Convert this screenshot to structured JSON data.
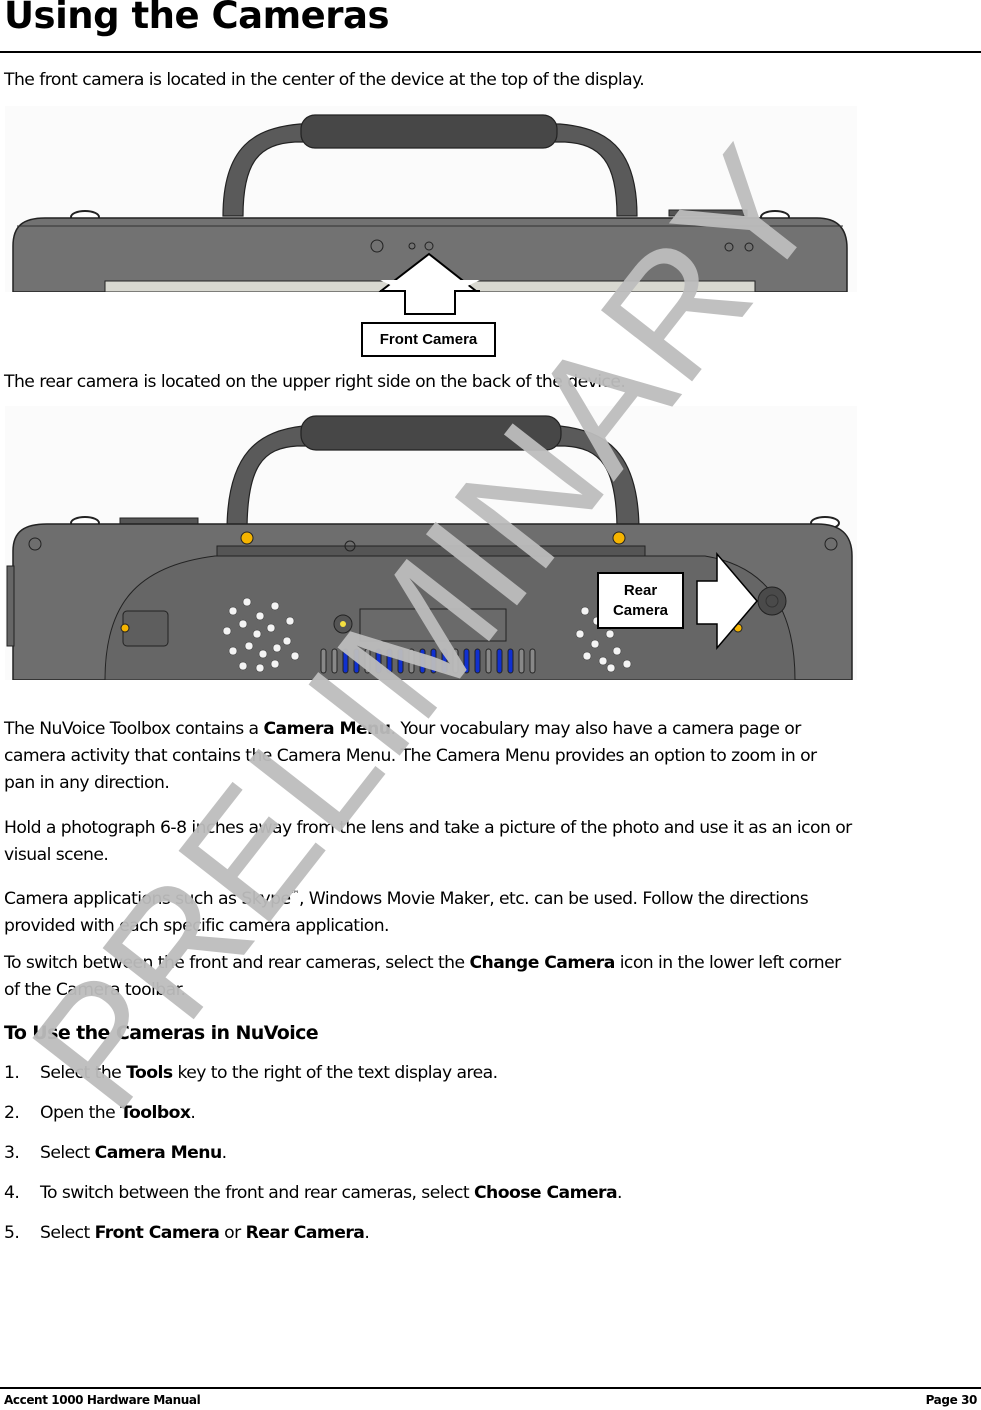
{
  "page": {
    "title": "Using the Cameras",
    "intro_front": "The front camera is located in the center of the device at the top of the display.",
    "intro_rear": "The rear camera is located on the upper right side on the back of the device."
  },
  "figures": {
    "front": {
      "callout_label": "Front Camera"
    },
    "rear": {
      "callout_line1": "Rear",
      "callout_line2": "Camera"
    }
  },
  "body": {
    "p1": {
      "pre": "The NuVoice Toolbox contains a ",
      "bold": "Camera Menu",
      "post_line1": ". Your vocabulary may also have a camera page or",
      "line2": "camera activity that contains the Camera Menu. The Camera Menu provides an option to zoom in or",
      "line3": "pan in any direction."
    },
    "p2": {
      "line1": "Hold a photograph 6-8 inches away from the lens and take a picture of the photo and use it as an icon or",
      "line2": "visual scene."
    },
    "p3": {
      "pre": "Camera applications such as Skype",
      "tm": "™",
      "post": ", Windows Movie Maker, etc. can be used. Follow the directions",
      "line2": "provided with each specific camera application."
    },
    "p4": {
      "pre": "To switch between the front and rear cameras, select the ",
      "bold": "Change Camera",
      "post": " icon in the lower left corner",
      "line2": "of the Camera toolbar."
    }
  },
  "section": {
    "heading": "To Use the Cameras in NuVoice",
    "steps": [
      {
        "num": "1.",
        "pre": "Select the ",
        "bold": "Tools",
        "post": " key to the right of the text display area.",
        "bold2": "",
        "post2": ""
      },
      {
        "num": "2.",
        "pre": "Open the ",
        "bold": "Toolbox",
        "post": ".",
        "bold2": "",
        "post2": ""
      },
      {
        "num": "3.",
        "pre": "Select ",
        "bold": "Camera Menu",
        "post": ".",
        "bold2": "",
        "post2": ""
      },
      {
        "num": "4.",
        "pre": "To switch between the front and rear cameras, select ",
        "bold": "Choose Camera",
        "post": ".",
        "bold2": "",
        "post2": ""
      },
      {
        "num": "5.",
        "pre": "Select ",
        "bold": "Front Camera",
        "post": " or ",
        "bold2": "Rear Camera",
        "post2": "."
      }
    ]
  },
  "footer": {
    "left": "Accent 1000 Hardware Manual",
    "right": "Page 30"
  },
  "watermark": {
    "text": "PRELIMINARY",
    "color": "#bdbdbd"
  },
  "colors": {
    "device_body": "#727272",
    "device_handle": "#4a4a4a",
    "screen": "#d8d8d0",
    "accent_yellow": "#f5b400",
    "vent_blue": "#1030d0"
  }
}
